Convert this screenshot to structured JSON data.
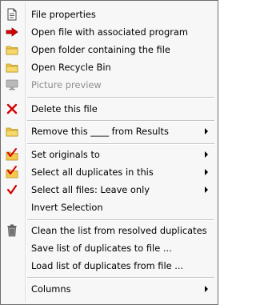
{
  "menu": {
    "items": [
      {
        "label": "File properties",
        "icon": "document-icon"
      },
      {
        "label": "Open file with associated program",
        "icon": "red-arrow-icon"
      },
      {
        "label": "Open folder containing the file",
        "icon": "folder-icon"
      },
      {
        "label": "Open Recycle Bin",
        "icon": "folder-icon"
      },
      {
        "label": "Picture preview",
        "icon": "monitor-icon",
        "disabled": true
      },
      {
        "label": "Delete this file",
        "icon": "red-x-icon"
      },
      {
        "label": "Remove this ____ from Results",
        "icon": "folder-icon",
        "submenu": true
      },
      {
        "label": "Set originals to",
        "icon": "checked-folder-icon",
        "submenu": true
      },
      {
        "label": "Select all duplicates in this",
        "icon": "checked-folder-icon",
        "submenu": true
      },
      {
        "label": "Select all files: Leave only",
        "icon": "red-check-icon",
        "submenu": true
      },
      {
        "label": "Invert Selection",
        "icon": "none"
      },
      {
        "label": "Clean the list from resolved duplicates",
        "icon": "trash-icon"
      },
      {
        "label": "Save list of duplicates to file ...",
        "icon": "none"
      },
      {
        "label": "Load list of duplicates from file ...",
        "icon": "none"
      },
      {
        "label": "Columns",
        "icon": "none",
        "submenu": true
      }
    ]
  },
  "colors": {
    "menu_background": "#f7f7f7",
    "border": "#6e6e6e",
    "disabled_text": "#8d8d8d",
    "accent_red": "#d60000",
    "folder_yellow": "#f2c94c"
  }
}
